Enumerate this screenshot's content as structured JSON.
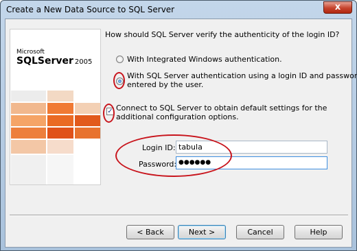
{
  "window": {
    "title": "Create a New Data Source to SQL Server",
    "close_glyph": "x"
  },
  "logo": {
    "microsoft": "Microsoft",
    "product": "SQLServer",
    "year": "2005",
    "colors": [
      "#e05a1c",
      "#f07a34",
      "#f2a56c",
      "#f5c9a4",
      "#e8e8e8"
    ]
  },
  "question": "How should SQL Server verify the authenticity of the login ID?",
  "options": [
    {
      "label": "With Integrated Windows authentication.",
      "selected": false
    },
    {
      "label_line1": "With SQL Server authentication using a login ID and password",
      "label_line2": "entered by the user.",
      "selected": true
    }
  ],
  "connect_checkbox": {
    "line1": "Connect to SQL Server to obtain default settings for the",
    "line2": "additional configuration options.",
    "checked": true,
    "check_glyph": "✓"
  },
  "login": {
    "login_label": "Login ID:",
    "login_value": "tabula",
    "password_label": "Password:",
    "password_value": "●●●●●●"
  },
  "buttons": {
    "back": "< Back",
    "next": "Next >",
    "cancel": "Cancel",
    "help": "Help"
  },
  "annotation_color": "#c8141c"
}
